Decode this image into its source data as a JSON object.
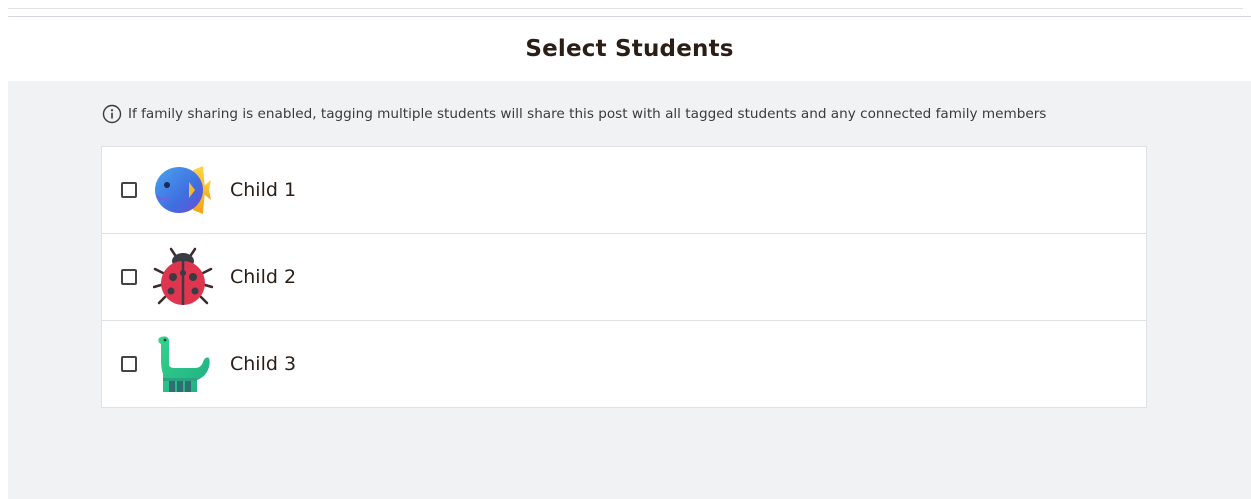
{
  "dialog": {
    "title": "Select Students",
    "info_text": "If family sharing is enabled, tagging multiple students will share this post with all tagged students and any connected family members"
  },
  "students": [
    {
      "name": "Child 1",
      "avatar": "fish-icon",
      "checked": false
    },
    {
      "name": "Child 2",
      "avatar": "ladybug-icon",
      "checked": false
    },
    {
      "name": "Child 3",
      "avatar": "dinosaur-icon",
      "checked": false
    }
  ],
  "colors": {
    "background": "#f1f2f4",
    "text": "#2a1e17",
    "border": "#dfe1e5"
  }
}
